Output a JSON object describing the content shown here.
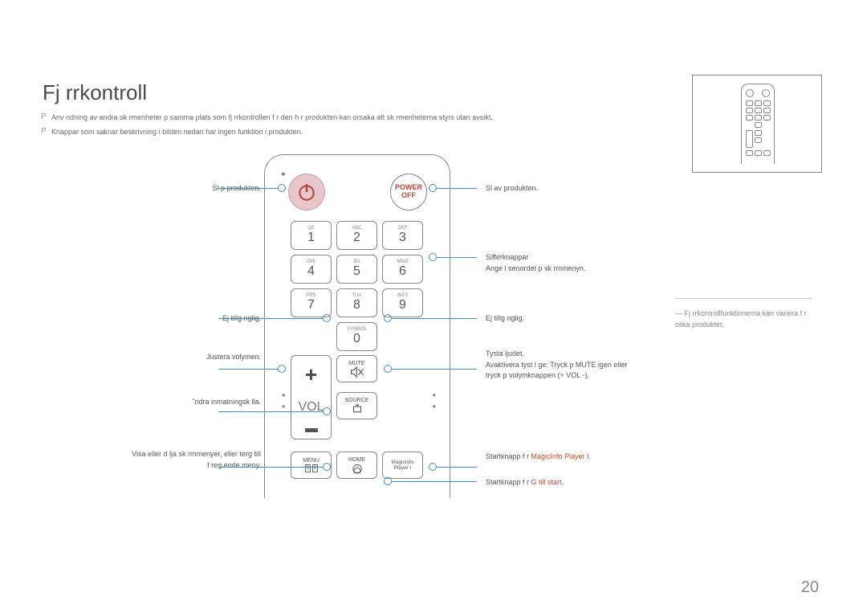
{
  "title": "Fj rrkontroll",
  "notes": [
    "Anv ndning av andra sk rmenheter p  samma plats som fj rrkontrollen f r den h r produkten kan orsaka att sk rmenheterna styrs utan avsikt.",
    "Knappar som saknar beskrivning i bilden nedan har ingen funktion i produkten."
  ],
  "left": {
    "power": "Sl  p  produkten.",
    "eti": "Ej tillg nglig.",
    "vol": "Justera volymen.",
    "src": "˜ndra inmatningsk lla.",
    "menu": "Visa eller d lja sk rmmenyer, eller  terg  till\nf reg ende meny."
  },
  "right": {
    "poff": "Sl  av produkten.",
    "num": "Sifferknappar\nAnge l senordet p  sk rmmenyn.",
    "eti": "Ej tillg nglig.",
    "mute": "Tysta ljudet.\nAvaktivera tyst l ge: Tryck p  MUTE igen eller\ntryck p  volymknappen (+ VOL -).",
    "mip_pre": "Startknapp f r ",
    "mip_hl": "MagicInfo Player I",
    "mip_post": ".",
    "home_pre": "Startknapp f r ",
    "home_hl": "G  till start",
    "home_post": "."
  },
  "keys": {
    "subs": [
      "QZ",
      "ABC",
      "DEF",
      "GHI",
      "JKL",
      "MNO",
      "PRS",
      "TUV",
      "WXY"
    ],
    "nums": [
      "1",
      "2",
      "3",
      "4",
      "5",
      "6",
      "7",
      "8",
      "9"
    ],
    "symbol": "SYMBOL",
    "zero": "0",
    "vol": "VOL",
    "mute": "MUTE",
    "source": "SOURCE",
    "menu": "MENU",
    "home": "HOME",
    "mip": "MagicInfo\nPlayer I",
    "poff1": "POWER",
    "poff2": "OFF"
  },
  "sidenote": "Fj rrkontrollfunktionerna kan variera f r olika produkter.",
  "page": "20"
}
